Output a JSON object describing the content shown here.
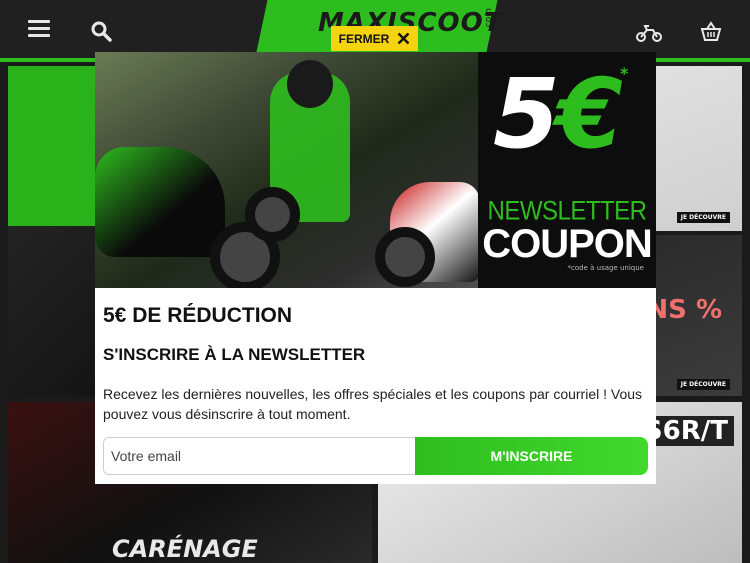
{
  "header": {
    "logo_text": "MAXISCOOT",
    "logo_suffix": ".com",
    "icons": [
      "menu-icon",
      "search-icon",
      "motorbike-icon",
      "cart-icon"
    ]
  },
  "background": {
    "tile_badge": "JE DÉCOUVRE",
    "promo_text": "NS %",
    "category_title": "CARÉNAGE",
    "brand_text": "S6R/T"
  },
  "popup": {
    "close_label": "FERMER",
    "banner": {
      "amount": "5",
      "currency": "€",
      "asterisk": "*",
      "line1": "NEWSLETTER",
      "line2": "COUPON",
      "fine_print": "*code à usage unique"
    },
    "title": "5€ DE RÉDUCTION",
    "subtitle": "S'INSCRIRE À LA NEWSLETTER",
    "description": "Recevez les dernières nouvelles, les offres spéciales et les coupons par courriel ! Vous pouvez vous désinscrire à tout moment.",
    "email_placeholder": "Votre email",
    "submit_label": "M'INSCRIRE"
  },
  "colors": {
    "brand_green": "#2ebd1e",
    "close_yellow": "#f6d30f",
    "header_dark": "#202020"
  }
}
